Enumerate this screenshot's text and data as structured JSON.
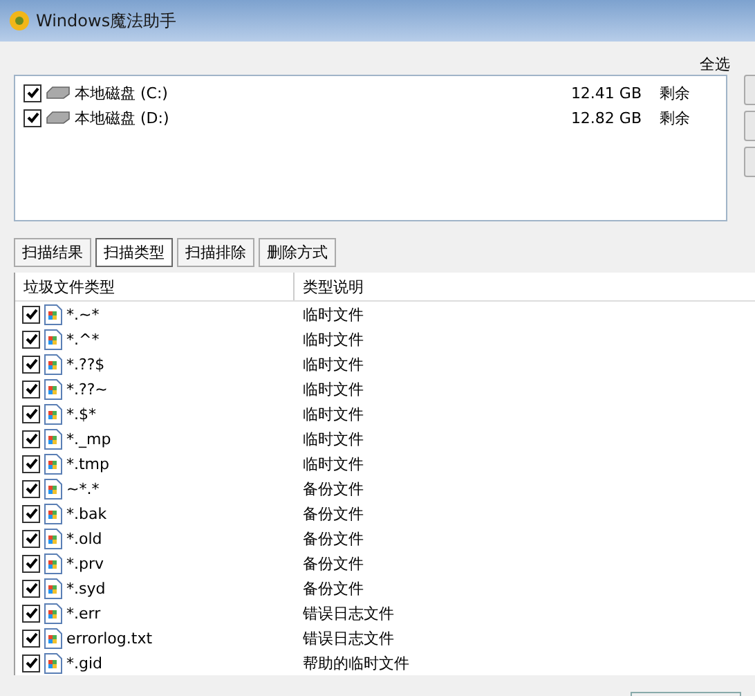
{
  "window": {
    "title": "Windows魔法助手"
  },
  "select_all": "全选",
  "disks": [
    {
      "name": "本地磁盘 (C:)",
      "free": "12.41 GB",
      "free_label": "剩余",
      "checked": true
    },
    {
      "name": "本地磁盘 (D:)",
      "free": "12.82 GB",
      "free_label": "剩余",
      "checked": true
    }
  ],
  "tabs": [
    {
      "label": "扫描结果",
      "selected": false
    },
    {
      "label": "扫描类型",
      "selected": true
    },
    {
      "label": "扫描排除",
      "selected": false
    },
    {
      "label": "删除方式",
      "selected": false
    }
  ],
  "table": {
    "columns": [
      "垃圾文件类型",
      "类型说明"
    ],
    "rows": [
      {
        "pattern": "*.~*",
        "description": "临时文件",
        "checked": true
      },
      {
        "pattern": "*.^*",
        "description": "临时文件",
        "checked": true
      },
      {
        "pattern": "*.??$",
        "description": "临时文件",
        "checked": true
      },
      {
        "pattern": "*.??~",
        "description": "临时文件",
        "checked": true
      },
      {
        "pattern": "*.$*",
        "description": "临时文件",
        "checked": true
      },
      {
        "pattern": "*._mp",
        "description": "临时文件",
        "checked": true
      },
      {
        "pattern": "*.tmp",
        "description": "临时文件",
        "checked": true
      },
      {
        "pattern": "~*.*",
        "description": "备份文件",
        "checked": true
      },
      {
        "pattern": "*.bak",
        "description": "备份文件",
        "checked": true
      },
      {
        "pattern": "*.old",
        "description": "备份文件",
        "checked": true
      },
      {
        "pattern": "*.prv",
        "description": "备份文件",
        "checked": true
      },
      {
        "pattern": "*.syd",
        "description": "备份文件",
        "checked": true
      },
      {
        "pattern": "*.err",
        "description": "错误日志文件",
        "checked": true
      },
      {
        "pattern": "errorlog.txt",
        "description": "错误日志文件",
        "checked": true
      },
      {
        "pattern": "*.gid",
        "description": "帮助的临时文件",
        "checked": true
      }
    ]
  }
}
